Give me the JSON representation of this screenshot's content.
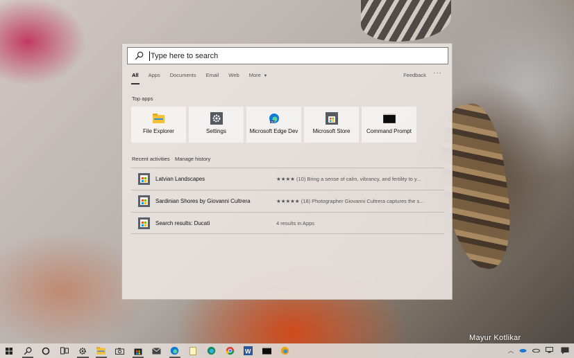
{
  "search": {
    "placeholder": "Type here to search"
  },
  "tabs": [
    {
      "label": "All",
      "active": true
    },
    {
      "label": "Apps"
    },
    {
      "label": "Documents"
    },
    {
      "label": "Email"
    },
    {
      "label": "Web"
    },
    {
      "label": "More"
    }
  ],
  "header_actions": {
    "feedback": "Feedback",
    "more": "···"
  },
  "top_apps": {
    "title": "Top apps",
    "items": [
      {
        "label": "File Explorer",
        "icon": "folder-icon"
      },
      {
        "label": "Settings",
        "icon": "gear-icon"
      },
      {
        "label": "Microsoft Edge Dev",
        "icon": "edge-dev-icon"
      },
      {
        "label": "Microsoft Store",
        "icon": "store-icon"
      },
      {
        "label": "Command Prompt",
        "icon": "terminal-icon"
      }
    ]
  },
  "recent": {
    "title": "Recent activities",
    "manage": "Manage history",
    "items": [
      {
        "name": "Latvian Landscapes",
        "detail": "★★★★ (10) Bring a sense of calm, vibrancy, and fertility to y..."
      },
      {
        "name": "Sardinian Shores by Giovanni Cultrera",
        "detail": "★★★★★ (18) Photographer Giovanni Cultrera captures the s..."
      },
      {
        "name": "Search results: Ducati",
        "detail": "4 results in Apps"
      }
    ]
  },
  "watermark": "Mayur Kotlikar",
  "taskbar": {
    "items": [
      "windows-start-icon",
      "search-icon",
      "cortana-icon",
      "task-view-icon",
      "settings-icon",
      "file-explorer-icon",
      "camera-icon",
      "store-icon",
      "mail-icon",
      "edge-dev-icon",
      "notepad-icon",
      "edge-icon",
      "chrome-icon",
      "word-icon",
      "terminal-icon",
      "edge-canary-icon"
    ],
    "tray": [
      "chevron-up-icon",
      "onedrive-icon",
      "cloud-icon",
      "network-icon",
      "notification-icon"
    ]
  },
  "colors": {
    "store_badge": "#5b6068",
    "edge_blue": "#0f78d4",
    "folder_yellow": "#f3c13a"
  }
}
